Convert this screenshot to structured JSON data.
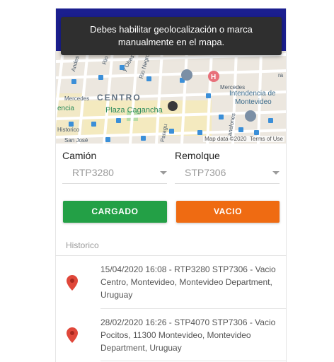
{
  "toast": {
    "line1": "Debes habilitar geolocalización o marca",
    "line2": "manualmente en el mapa."
  },
  "map": {
    "labels": {
      "centro": "CENTRO",
      "plaza": "Plaza Cagancha",
      "intendencia_1": "Intendencia de",
      "intendencia_2": "Montevideo",
      "mercedes_left": "Mercedes",
      "mercedes_right": "Mercedes",
      "historico": "Historico",
      "san_jose": "San José",
      "rio_branco": "Rio Branco",
      "rio_negro": "Rio Negro",
      "andes": "Andes",
      "obes": "y Obes",
      "paraguay": "Paragu",
      "canelones": "Canelones",
      "rosa": "ra",
      "encia": "encia"
    },
    "credit_data": "Map data ©2020",
    "credit_terms": "Terms of Use"
  },
  "form": {
    "camion_label": "Camión",
    "camion_value": "RTP3280",
    "remolque_label": "Remolque",
    "remolque_value": "STP7306"
  },
  "buttons": {
    "cargado": "CARGADO",
    "vacio": "VACIO"
  },
  "history": {
    "title": "Historico",
    "items": [
      {
        "line1": "15/04/2020 16:08 - RTP3280 STP7306 - Vacio",
        "line2": "Centro, Montevideo, Montevideo Department,",
        "line3": "Uruguay"
      },
      {
        "line1": "28/02/2020 16:26 - STP4070 STP7306 - Vacio",
        "line2": "Pocitos, 11300 Montevideo, Montevideo",
        "line3": "Department, Uruguay"
      }
    ]
  },
  "colors": {
    "appbar": "#1b1f8f",
    "cargado": "#23a046",
    "vacio": "#ef6b12",
    "pin": "#e0473a"
  }
}
